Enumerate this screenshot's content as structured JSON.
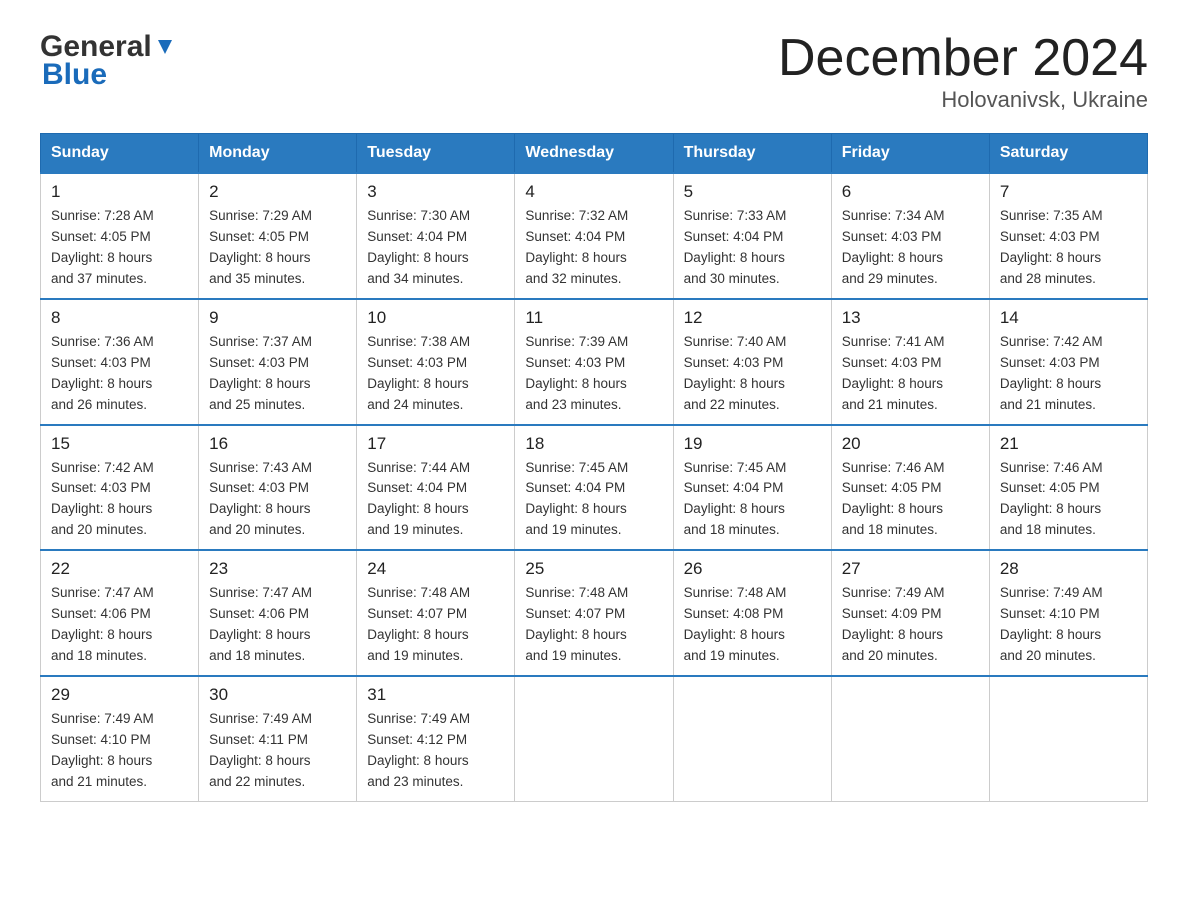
{
  "header": {
    "logo_general": "General",
    "logo_blue": "Blue",
    "month_title": "December 2024",
    "location": "Holovanivsk, Ukraine"
  },
  "days_of_week": [
    "Sunday",
    "Monday",
    "Tuesday",
    "Wednesday",
    "Thursday",
    "Friday",
    "Saturday"
  ],
  "weeks": [
    [
      {
        "day": "1",
        "sunrise": "7:28 AM",
        "sunset": "4:05 PM",
        "daylight": "8 hours and 37 minutes."
      },
      {
        "day": "2",
        "sunrise": "7:29 AM",
        "sunset": "4:05 PM",
        "daylight": "8 hours and 35 minutes."
      },
      {
        "day": "3",
        "sunrise": "7:30 AM",
        "sunset": "4:04 PM",
        "daylight": "8 hours and 34 minutes."
      },
      {
        "day": "4",
        "sunrise": "7:32 AM",
        "sunset": "4:04 PM",
        "daylight": "8 hours and 32 minutes."
      },
      {
        "day": "5",
        "sunrise": "7:33 AM",
        "sunset": "4:04 PM",
        "daylight": "8 hours and 30 minutes."
      },
      {
        "day": "6",
        "sunrise": "7:34 AM",
        "sunset": "4:03 PM",
        "daylight": "8 hours and 29 minutes."
      },
      {
        "day": "7",
        "sunrise": "7:35 AM",
        "sunset": "4:03 PM",
        "daylight": "8 hours and 28 minutes."
      }
    ],
    [
      {
        "day": "8",
        "sunrise": "7:36 AM",
        "sunset": "4:03 PM",
        "daylight": "8 hours and 26 minutes."
      },
      {
        "day": "9",
        "sunrise": "7:37 AM",
        "sunset": "4:03 PM",
        "daylight": "8 hours and 25 minutes."
      },
      {
        "day": "10",
        "sunrise": "7:38 AM",
        "sunset": "4:03 PM",
        "daylight": "8 hours and 24 minutes."
      },
      {
        "day": "11",
        "sunrise": "7:39 AM",
        "sunset": "4:03 PM",
        "daylight": "8 hours and 23 minutes."
      },
      {
        "day": "12",
        "sunrise": "7:40 AM",
        "sunset": "4:03 PM",
        "daylight": "8 hours and 22 minutes."
      },
      {
        "day": "13",
        "sunrise": "7:41 AM",
        "sunset": "4:03 PM",
        "daylight": "8 hours and 21 minutes."
      },
      {
        "day": "14",
        "sunrise": "7:42 AM",
        "sunset": "4:03 PM",
        "daylight": "8 hours and 21 minutes."
      }
    ],
    [
      {
        "day": "15",
        "sunrise": "7:42 AM",
        "sunset": "4:03 PM",
        "daylight": "8 hours and 20 minutes."
      },
      {
        "day": "16",
        "sunrise": "7:43 AM",
        "sunset": "4:03 PM",
        "daylight": "8 hours and 20 minutes."
      },
      {
        "day": "17",
        "sunrise": "7:44 AM",
        "sunset": "4:04 PM",
        "daylight": "8 hours and 19 minutes."
      },
      {
        "day": "18",
        "sunrise": "7:45 AM",
        "sunset": "4:04 PM",
        "daylight": "8 hours and 19 minutes."
      },
      {
        "day": "19",
        "sunrise": "7:45 AM",
        "sunset": "4:04 PM",
        "daylight": "8 hours and 18 minutes."
      },
      {
        "day": "20",
        "sunrise": "7:46 AM",
        "sunset": "4:05 PM",
        "daylight": "8 hours and 18 minutes."
      },
      {
        "day": "21",
        "sunrise": "7:46 AM",
        "sunset": "4:05 PM",
        "daylight": "8 hours and 18 minutes."
      }
    ],
    [
      {
        "day": "22",
        "sunrise": "7:47 AM",
        "sunset": "4:06 PM",
        "daylight": "8 hours and 18 minutes."
      },
      {
        "day": "23",
        "sunrise": "7:47 AM",
        "sunset": "4:06 PM",
        "daylight": "8 hours and 18 minutes."
      },
      {
        "day": "24",
        "sunrise": "7:48 AM",
        "sunset": "4:07 PM",
        "daylight": "8 hours and 19 minutes."
      },
      {
        "day": "25",
        "sunrise": "7:48 AM",
        "sunset": "4:07 PM",
        "daylight": "8 hours and 19 minutes."
      },
      {
        "day": "26",
        "sunrise": "7:48 AM",
        "sunset": "4:08 PM",
        "daylight": "8 hours and 19 minutes."
      },
      {
        "day": "27",
        "sunrise": "7:49 AM",
        "sunset": "4:09 PM",
        "daylight": "8 hours and 20 minutes."
      },
      {
        "day": "28",
        "sunrise": "7:49 AM",
        "sunset": "4:10 PM",
        "daylight": "8 hours and 20 minutes."
      }
    ],
    [
      {
        "day": "29",
        "sunrise": "7:49 AM",
        "sunset": "4:10 PM",
        "daylight": "8 hours and 21 minutes."
      },
      {
        "day": "30",
        "sunrise": "7:49 AM",
        "sunset": "4:11 PM",
        "daylight": "8 hours and 22 minutes."
      },
      {
        "day": "31",
        "sunrise": "7:49 AM",
        "sunset": "4:12 PM",
        "daylight": "8 hours and 23 minutes."
      },
      null,
      null,
      null,
      null
    ]
  ],
  "labels": {
    "sunrise": "Sunrise:",
    "sunset": "Sunset:",
    "daylight": "Daylight:"
  }
}
